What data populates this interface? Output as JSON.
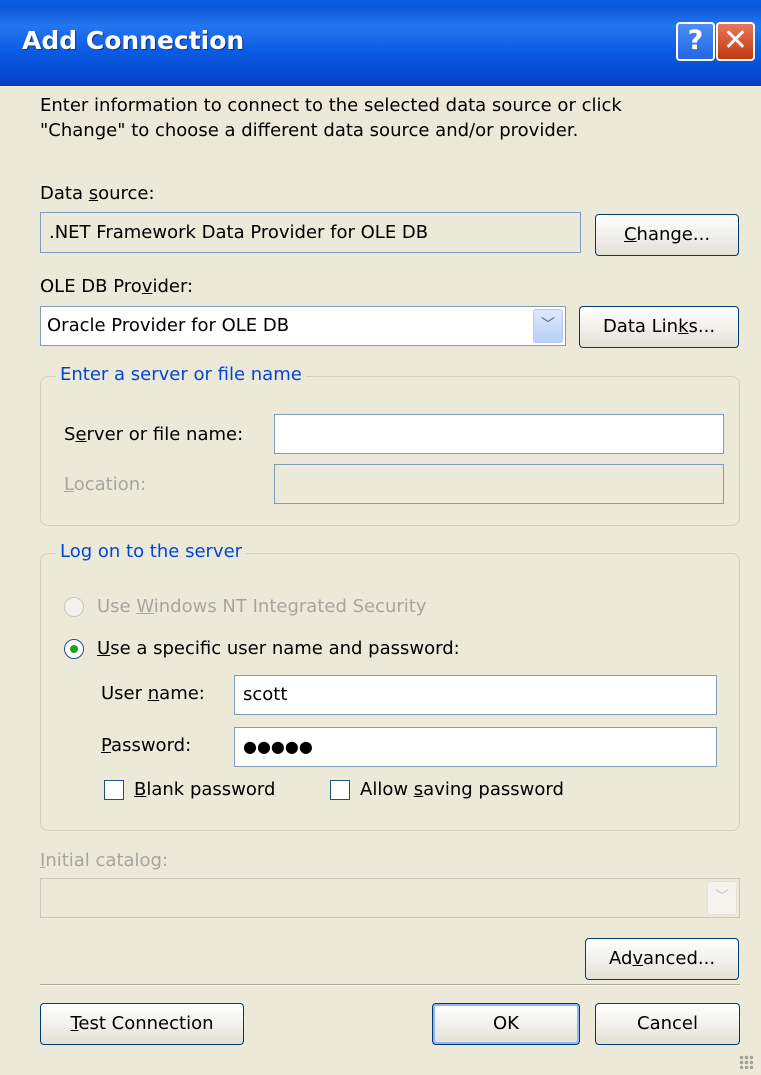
{
  "window": {
    "title": "Add Connection",
    "help_glyph": "?",
    "close_glyph": "✕"
  },
  "intro": {
    "line1": "Enter information to connect to the selected data source or click",
    "line2": "\"Change\" to choose a different data source and/or provider."
  },
  "data_source": {
    "label_pre": "Data ",
    "label_key": "s",
    "label_post": "ource:",
    "value": ".NET Framework Data Provider for OLE DB",
    "change_pre": "",
    "change_key": "C",
    "change_post": "hange..."
  },
  "provider": {
    "label_pre": "OLE DB Pro",
    "label_key": "v",
    "label_post": "ider:",
    "value": "Oracle Provider for OLE DB",
    "links_pre": "Data Lin",
    "links_key": "k",
    "links_post": "s..."
  },
  "server_group": {
    "legend": "Enter a server or file name",
    "server_pre": "S",
    "server_key": "e",
    "server_post": "rver or file name:",
    "server_value": "",
    "location_pre": "",
    "location_key": "L",
    "location_post": "ocation:",
    "location_value": ""
  },
  "logon_group": {
    "legend": "Log on to the server",
    "nt_pre": "Use ",
    "nt_key": "W",
    "nt_post": "indows NT Integrated Security",
    "specific_pre": "",
    "specific_key": "U",
    "specific_post": "se a specific user name and password:",
    "user_pre": "User ",
    "user_key": "n",
    "user_post": "ame:",
    "user_value": "scott",
    "pass_pre": "",
    "pass_key": "P",
    "pass_post": "assword:",
    "pass_value": "●●●●●",
    "blank_pre": "",
    "blank_key": "B",
    "blank_post": "lank password",
    "allow_pre": "Allow ",
    "allow_key": "s",
    "allow_post": "aving password"
  },
  "catalog": {
    "label_pre": "",
    "label_key": "I",
    "label_post": "nitial catalog:",
    "value": ""
  },
  "buttons": {
    "advanced_pre": "Ad",
    "advanced_key": "v",
    "advanced_post": "anced...",
    "test_pre": "",
    "test_key": "T",
    "test_post": "est Connection",
    "ok": "OK",
    "cancel": "Cancel"
  },
  "dropdown_glyph": "﹀"
}
